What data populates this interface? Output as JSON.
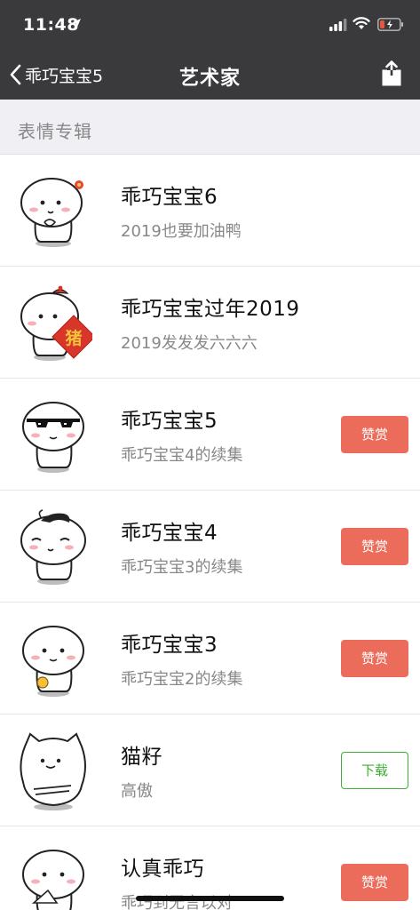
{
  "status": {
    "time": "11:48"
  },
  "nav": {
    "back_label": "乖巧宝宝5",
    "title": "艺术家"
  },
  "section": {
    "title": "表情专辑"
  },
  "albums": [
    {
      "title": "乖巧宝宝6",
      "subtitle": "2019也要加油鸭",
      "button": ""
    },
    {
      "title": "乖巧宝宝过年2019",
      "subtitle": "2019发发发六六六",
      "button": "",
      "badge_char": "猪"
    },
    {
      "title": "乖巧宝宝5",
      "subtitle": "乖巧宝宝4的续集",
      "button": "赞赏"
    },
    {
      "title": "乖巧宝宝4",
      "subtitle": "乖巧宝宝3的续集",
      "button": "赞赏"
    },
    {
      "title": "乖巧宝宝3",
      "subtitle": "乖巧宝宝2的续集",
      "button": "赞赏"
    },
    {
      "title": "猫籽",
      "subtitle": "高傲",
      "button": "下载"
    },
    {
      "title": "认真乖巧",
      "subtitle": "乖巧到无言以对",
      "button": "赞赏"
    }
  ],
  "colors": {
    "bar": "#3a3a3d",
    "reward": "#ec6c5b",
    "download": "#3fae35"
  },
  "icons": [
    "location-arrow-icon",
    "signal-icon",
    "wifi-icon",
    "battery-low-icon",
    "back-chevron-icon",
    "share-icon"
  ]
}
